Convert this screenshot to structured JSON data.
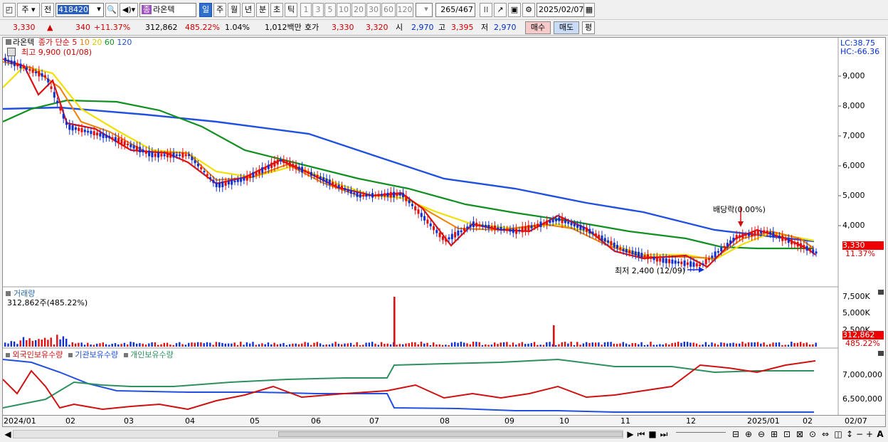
{
  "toolbar": {
    "type_value": "주",
    "type2": "전",
    "code": "418420",
    "stock_name": "라온텍",
    "stock_prefix": "종",
    "periods": [
      "일",
      "주",
      "월",
      "년",
      "분",
      "초",
      "틱"
    ],
    "selected_period": "일",
    "nums": [
      "1",
      "3",
      "5",
      "10",
      "20",
      "30",
      "60",
      "120"
    ],
    "count_shown": "265",
    "count_total": "/467",
    "date": "2025/02/07"
  },
  "quote": {
    "price": "3,330",
    "arrow": "▲",
    "change": "340",
    "change_pct": "+11.37%",
    "volume": "312,862",
    "volume_pct": "485.22%",
    "turnover": "1.04%",
    "amount": "1,012백만",
    "hoga_label": "호가",
    "hoga_ask": "3,330",
    "hoga_bid": "3,320",
    "open_label": "시",
    "open": "2,970",
    "high_label": "고",
    "high": "3,395",
    "low_label": "저",
    "low": "2,970",
    "buy_label": "매수",
    "sell_label": "매도",
    "eval_label": "평"
  },
  "price_panel": {
    "legend_name": "라온텍",
    "legend_ma_label": "종가 단순",
    "ma_periods": [
      "5",
      "10",
      "20",
      "60",
      "120"
    ],
    "ma_colors": [
      "#e01010",
      "#f08000",
      "#f0e000",
      "#109020",
      "#2050e0"
    ],
    "high_label": "최고 9,900 (01/08)",
    "low_label": "최저 2,400 (12/09)",
    "dividend_label": "배당락(0.00%)",
    "lc": "LC:38.75",
    "hc": "HC:-66.36",
    "y_ticks": [
      "9,000",
      "8,000",
      "7,000",
      "6,000",
      "5,000",
      "4,000"
    ],
    "current_price_tag": "3,330",
    "current_pct_tag": "11.37%"
  },
  "volume_panel": {
    "title": "거래량",
    "value_label": "312,862주(485.22%)",
    "y_ticks": [
      "7,500K",
      "5,000K",
      "2,500K"
    ],
    "current_tag": "312,862",
    "pct_tag": "485.22%"
  },
  "holdings_panel": {
    "legend": [
      "외국인보유수량",
      "기관보유수량",
      "개인보유수량"
    ],
    "colors": [
      "#d01010",
      "#2050e0",
      "#2e9060"
    ],
    "y_ticks": [
      "7,000,000",
      "6,500,000"
    ]
  },
  "x_axis": [
    "2024/01",
    "02",
    "03",
    "04",
    "05",
    "06",
    "07",
    "08",
    "09",
    "10",
    "11",
    "12",
    "2025/01",
    "02",
    "02/07"
  ]
}
